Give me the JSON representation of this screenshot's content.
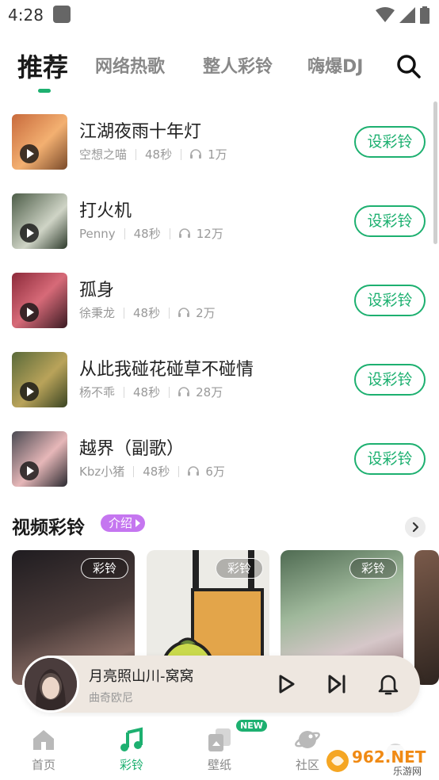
{
  "status_bar": {
    "time": "4:28"
  },
  "tabs": [
    {
      "label": "推荐",
      "active": true
    },
    {
      "label": "网络热歌",
      "active": false
    },
    {
      "label": "整人彩铃",
      "active": false
    },
    {
      "label": "嗨爆DJ",
      "active": false
    }
  ],
  "songs": [
    {
      "title": "江湖夜雨十年灯",
      "artist": "空想之喵",
      "duration": "48秒",
      "plays": "1万",
      "button": "设彩铃"
    },
    {
      "title": "打火机",
      "artist": "Penny",
      "duration": "48秒",
      "plays": "12万",
      "button": "设彩铃"
    },
    {
      "title": "孤身",
      "artist": "徐秉龙",
      "duration": "48秒",
      "plays": "2万",
      "button": "设彩铃"
    },
    {
      "title": "从此我碰花碰草不碰情",
      "artist": "杨不乖",
      "duration": "48秒",
      "plays": "28万",
      "button": "设彩铃"
    },
    {
      "title": "越界（副歌）",
      "artist": "Kbz小猪",
      "duration": "48秒",
      "plays": "6万",
      "button": "设彩铃"
    }
  ],
  "video_section": {
    "title": "视频彩铃",
    "intro_badge": "介绍",
    "cards": [
      {
        "tag": "彩铃"
      },
      {
        "tag": "彩铃"
      },
      {
        "tag": "彩铃"
      }
    ]
  },
  "player": {
    "title": "月亮照山川-窝窝",
    "artist": "曲奇欧尼"
  },
  "bottom_nav": [
    {
      "label": "首页",
      "active": false
    },
    {
      "label": "彩铃",
      "active": true
    },
    {
      "label": "壁纸",
      "active": false,
      "badge": "NEW"
    },
    {
      "label": "社区",
      "active": false
    }
  ],
  "watermark": {
    "text_main": "962.NET",
    "text_sub": "乐游网"
  },
  "colors": {
    "accent": "#1db070",
    "intro": "#c576f0",
    "player_bg": "#eee7e0"
  }
}
